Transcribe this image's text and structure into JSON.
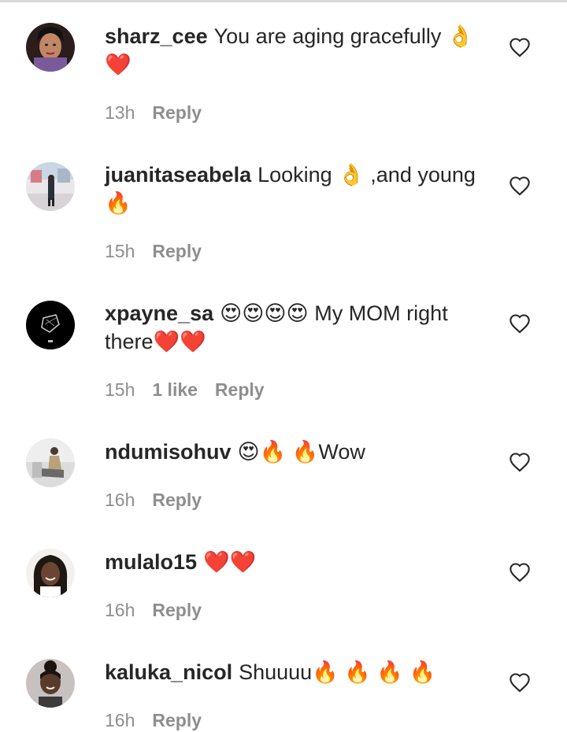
{
  "comments": [
    {
      "username": "sharz_cee",
      "text": "You are aging gracefully 👌 ❤️",
      "time": "13h",
      "likes": "",
      "reply": "Reply"
    },
    {
      "username": "juanitaseabela",
      "text": "Looking 👌 ,and young 🔥",
      "time": "15h",
      "likes": "",
      "reply": "Reply"
    },
    {
      "username": "xpayne_sa",
      "text": "😍😍😍😍 My MOM right there❤️❤️",
      "time": "15h",
      "likes": "1 like",
      "reply": "Reply"
    },
    {
      "username": "ndumisohuv",
      "text": "😍🔥 🔥Wow",
      "time": "16h",
      "likes": "",
      "reply": "Reply"
    },
    {
      "username": "mulalo15",
      "text": "❤️❤️",
      "time": "16h",
      "likes": "",
      "reply": "Reply"
    },
    {
      "username": "kaluka_nicol",
      "text": "Shuuuu🔥 🔥 🔥 🔥",
      "time": "16h",
      "likes": "",
      "reply": "Reply"
    }
  ],
  "icons": {
    "like": "heart-outline-icon"
  },
  "colors": {
    "text": "#262626",
    "meta": "#8e8e8e",
    "heart": "#e0245e",
    "fire": "#f5a623"
  }
}
